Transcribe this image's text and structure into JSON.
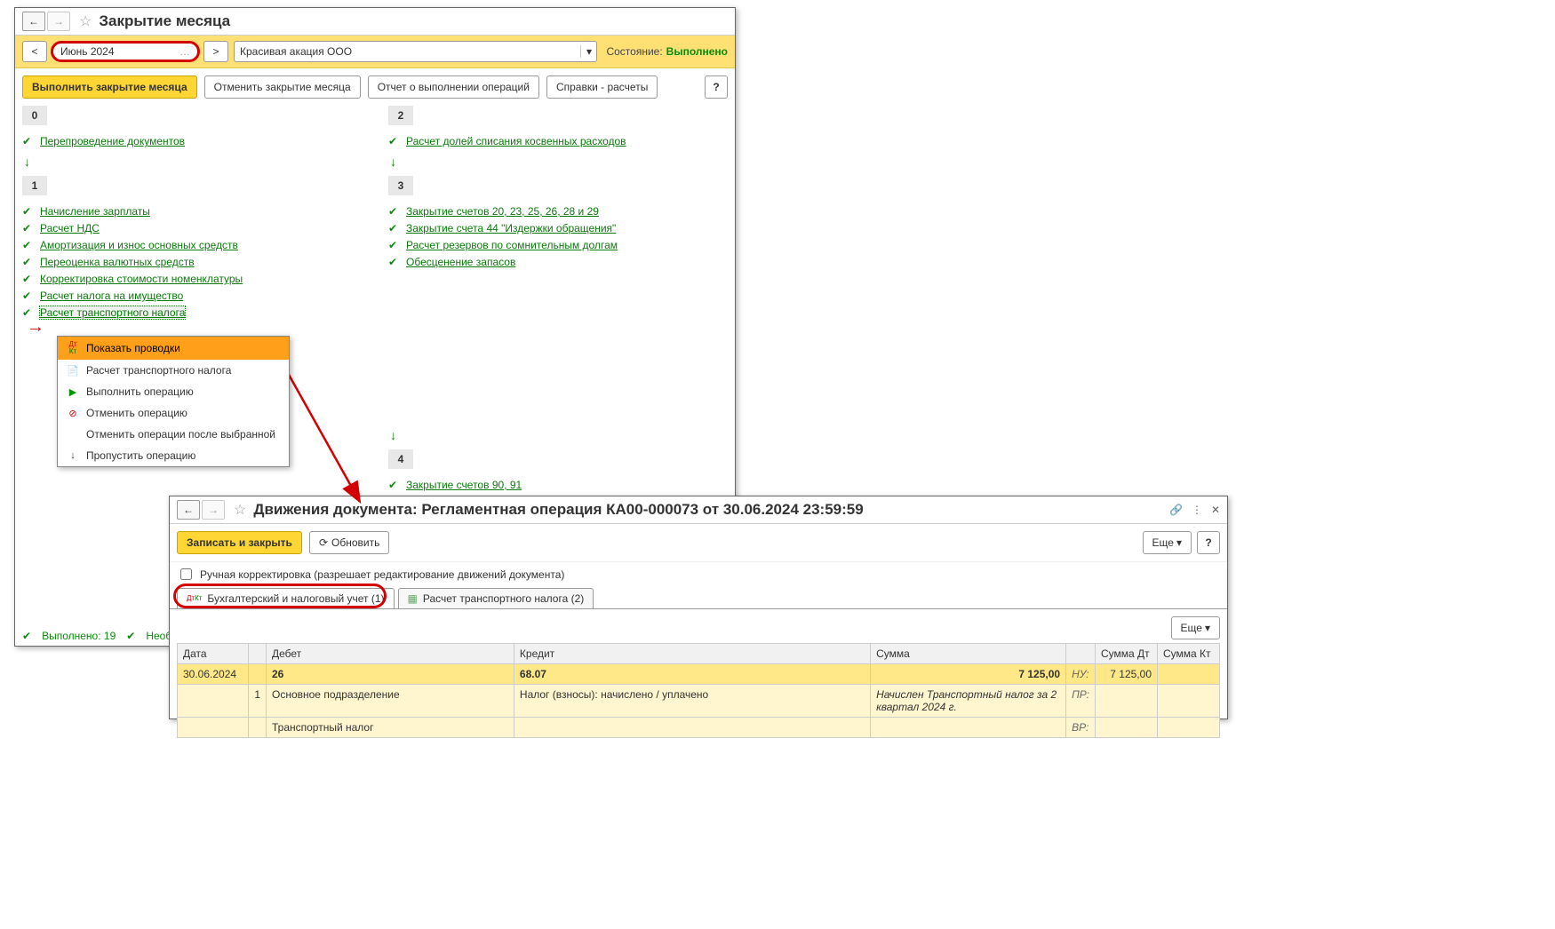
{
  "win1": {
    "title": "Закрытие месяца",
    "period": "Июнь 2024",
    "org": "Красивая акация ООО",
    "state_label": "Состояние:",
    "state_value": "Выполнено",
    "btn_execute": "Выполнить закрытие месяца",
    "btn_cancel": "Отменить закрытие месяца",
    "btn_report": "Отчет о выполнении операций",
    "btn_ref": "Справки - расчеты",
    "help": "?",
    "blocks": {
      "b0": "0",
      "b1": "1",
      "b2": "2",
      "b3": "3",
      "b4": "4"
    },
    "ops_left0": [
      "Перепроведение документов"
    ],
    "ops_left1": [
      "Начисление зарплаты",
      "Расчет НДС",
      "Амортизация и износ основных средств",
      "Переоценка валютных средств",
      "Корректировка стоимости номенклатуры",
      "Расчет налога на имущество",
      "Расчет транспортного налога"
    ],
    "ops_right2": [
      "Расчет долей списания косвенных расходов"
    ],
    "ops_right3": [
      "Закрытие счетов 20, 23, 25, 26, 28 и 29",
      "Закрытие счета 44 \"Издержки обращения\"",
      "Расчет резервов по сомнительным долгам",
      "Обесценение запасов"
    ],
    "ops_right4": [
      "Закрытие счетов 90, 91"
    ],
    "status_done_label": "Выполнено:",
    "status_done_count": "19",
    "status_need_label": "Необхо..."
  },
  "context_menu": {
    "items": [
      "Показать проводки",
      "Расчет транспортного налога",
      "Выполнить операцию",
      "Отменить операцию",
      "Отменить операции после выбранной",
      "Пропустить операцию"
    ]
  },
  "win2": {
    "title": "Движения документа: Регламентная операция КА00-000073 от 30.06.2024 23:59:59",
    "btn_save": "Записать и закрыть",
    "btn_refresh": "Обновить",
    "btn_more": "Еще",
    "help": "?",
    "manual_label": "Ручная корректировка (разрешает редактирование движений документа)",
    "tab1": "Бухгалтерский и налоговый учет (1)",
    "tab2": "Расчет транспортного налога (2)",
    "grid": {
      "headers": {
        "date": "Дата",
        "debit": "Дебет",
        "credit": "Кредит",
        "amount": "Сумма",
        "amount_dt": "Сумма Дт",
        "amount_kt": "Сумма Кт"
      },
      "row1": {
        "date": "30.06.2024",
        "debit": "26",
        "credit": "68.07",
        "amount": "7 125,00",
        "nu": "НУ:",
        "amount_dt": "7 125,00"
      },
      "row2": {
        "num": "1",
        "debit_sub": "Основное подразделение",
        "credit_sub": "Налог (взносы): начислено / уплачено",
        "desc": "Начислен Транспортный налог за 2 квартал 2024 г.",
        "pr": "ПР:"
      },
      "row3": {
        "debit_sub": "Транспортный налог",
        "vr": "ВР:"
      }
    }
  }
}
